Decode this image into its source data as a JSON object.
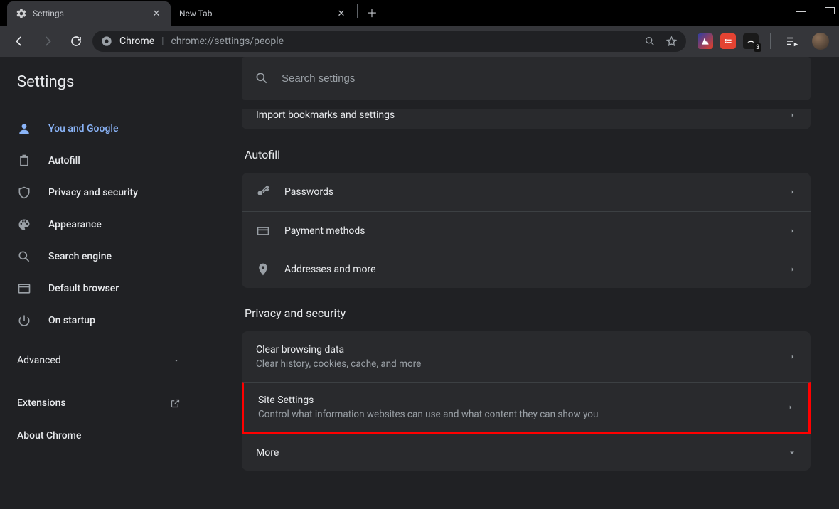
{
  "window": {
    "tabs": [
      {
        "title": "Settings",
        "active": true
      },
      {
        "title": "New Tab",
        "active": false
      }
    ]
  },
  "toolbar": {
    "origin": "Chrome",
    "url_path": "chrome://settings/people",
    "ext_badge": "3"
  },
  "sidebar": {
    "title": "Settings",
    "items": [
      {
        "label": "You and Google",
        "active": true
      },
      {
        "label": "Autofill"
      },
      {
        "label": "Privacy and security"
      },
      {
        "label": "Appearance"
      },
      {
        "label": "Search engine"
      },
      {
        "label": "Default browser"
      },
      {
        "label": "On startup"
      }
    ],
    "advanced": "Advanced",
    "extensions": "Extensions",
    "about": "About Chrome"
  },
  "search": {
    "placeholder": "Search settings"
  },
  "sections": {
    "import_row": "Import bookmarks and settings",
    "autofill": {
      "title": "Autofill",
      "rows": [
        {
          "label": "Passwords"
        },
        {
          "label": "Payment methods"
        },
        {
          "label": "Addresses and more"
        }
      ]
    },
    "privacy": {
      "title": "Privacy and security",
      "rows": [
        {
          "label": "Clear browsing data",
          "sub": "Clear history, cookies, cache, and more"
        },
        {
          "label": "Site Settings",
          "sub": "Control what information websites can use and what content they can show you",
          "highlight": true
        },
        {
          "label": "More",
          "expand": true
        }
      ]
    }
  }
}
